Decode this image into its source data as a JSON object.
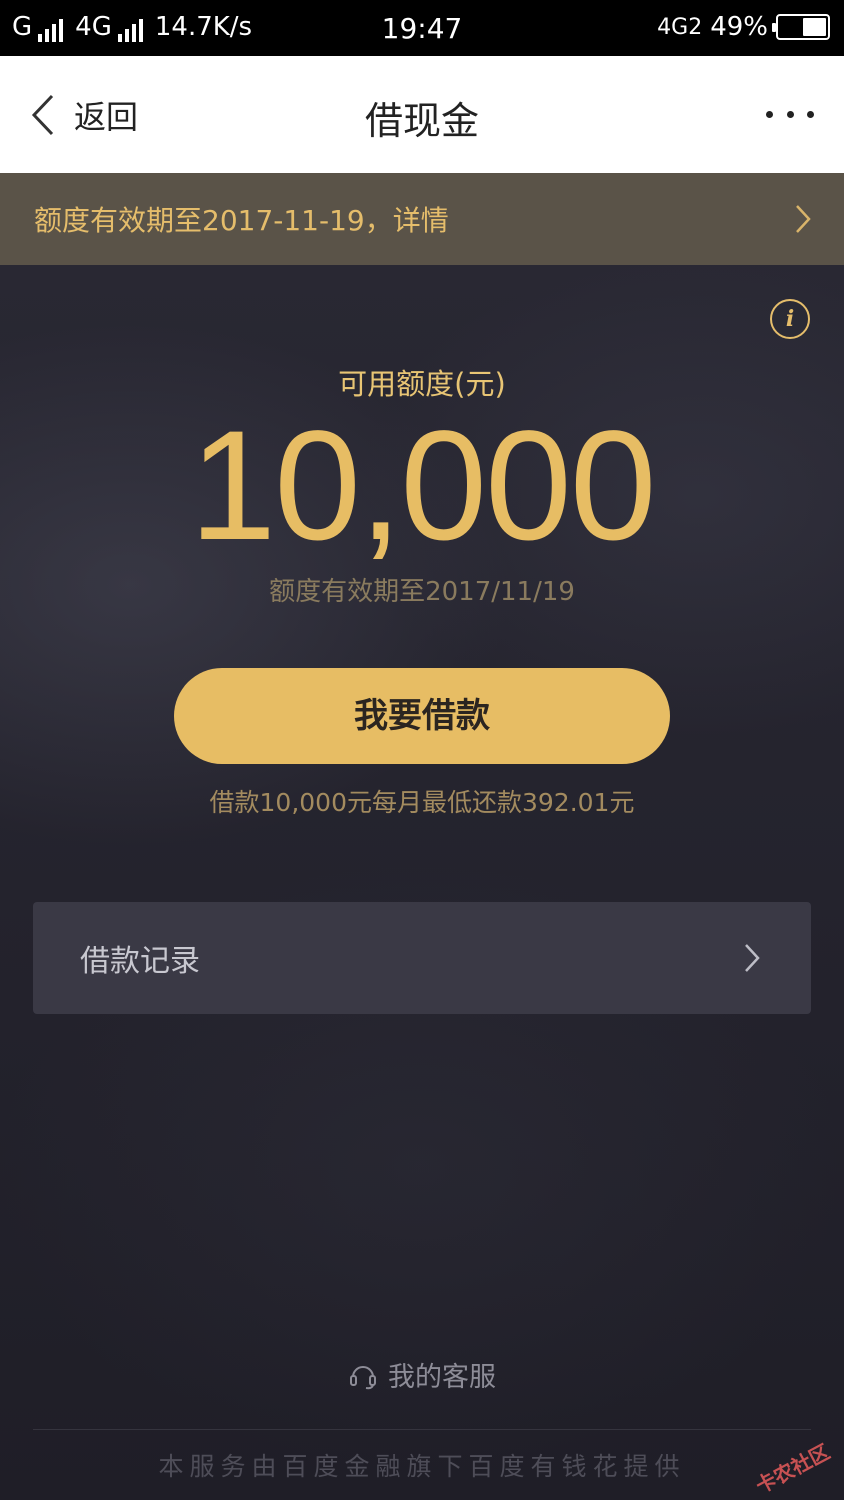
{
  "status_bar": {
    "carrier1": "G",
    "carrier2": "4G",
    "speed": "14.7K/s",
    "time": "19:47",
    "network_right": "4G2",
    "battery": "49%",
    "battery_level": 0.49
  },
  "nav": {
    "back_label": "返回",
    "title": "借现金"
  },
  "notice": {
    "text": "额度有效期至2017-11-19，详情"
  },
  "credit": {
    "label": "可用额度(元)",
    "amount": "10,000",
    "expiry": "额度有效期至2017/11/19"
  },
  "borrow": {
    "button_label": "我要借款",
    "repay_note": "借款10,000元每月最低还款392.01元"
  },
  "records": {
    "label": "借款记录"
  },
  "service": {
    "label": "我的客服"
  },
  "footer": {
    "text": "本服务由百度金融旗下百度有钱花提供"
  },
  "watermark": "卡农社区",
  "colors": {
    "accent_gold": "#e7bd64",
    "background": "#24232d",
    "notice_bg": "#5a5348"
  }
}
